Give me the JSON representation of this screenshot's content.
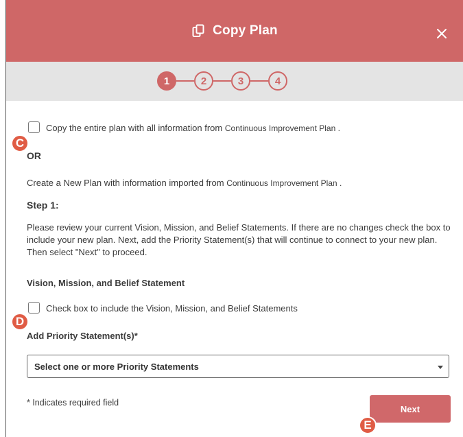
{
  "header": {
    "title": "Copy Plan",
    "icons": {
      "copy": "copy-icon",
      "close": "close-icon"
    }
  },
  "stepper": {
    "steps": [
      "1",
      "2",
      "3",
      "4"
    ],
    "active_step": "1"
  },
  "options": {
    "copy_entire": "Copy the entire plan with all information from",
    "copy_entire_source": "Continuous Improvement Plan .",
    "or_label": "OR",
    "create_new": "Create a New Plan with information imported from",
    "create_new_source": "Continuous Improvement Plan ."
  },
  "step_section": {
    "heading": "Step 1:",
    "instructions": "Please review your current Vision, Mission, and Belief Statements. If there are no changes check the box to include your new plan. Next, add the Priority Statement(s) that will continue to connect to your new plan. Then select \"Next\" to proceed."
  },
  "vision": {
    "heading": "Vision, Mission, and Belief Statement",
    "checkbox_label": "Check box to include the Vision, Mission, and Belief Statements"
  },
  "priority": {
    "label": "Add Priority Statement(s)*",
    "select_placeholder": "Select one or more Priority Statements"
  },
  "footer": {
    "required_note": "* Indicates required field",
    "next_label": "Next"
  },
  "markers": {
    "c": "C",
    "d": "D",
    "e": "E"
  },
  "colors": {
    "header_bg": "#cf6767",
    "stepper_bg": "#e4e4e4",
    "marker_bg": "#e05c45",
    "button_bg": "#d0686a"
  }
}
